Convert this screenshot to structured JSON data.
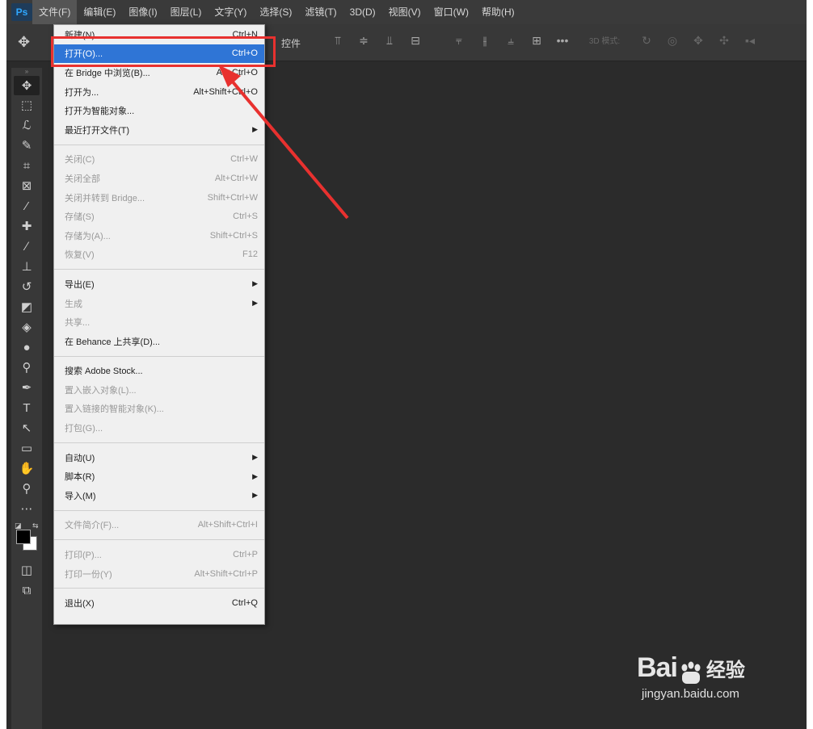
{
  "menubar": {
    "logo": "Ps",
    "items": [
      "文件(F)",
      "编辑(E)",
      "图像(I)",
      "图层(L)",
      "文字(Y)",
      "选择(S)",
      "滤镜(T)",
      "3D(D)",
      "视图(V)",
      "窗口(W)",
      "帮助(H)"
    ]
  },
  "optionsbar": {
    "label": "控件",
    "mode_text": "3D 模式:"
  },
  "file_menu": {
    "items": [
      {
        "label": "新建(N)...",
        "shortcut": "Ctrl+N",
        "state": "normal"
      },
      {
        "label": "打开(O)...",
        "shortcut": "Ctrl+O",
        "state": "highlight"
      },
      {
        "label": "在 Bridge 中浏览(B)...",
        "shortcut": "Alt+Ctrl+O",
        "state": "normal"
      },
      {
        "label": "打开为...",
        "shortcut": "Alt+Shift+Ctrl+O",
        "state": "normal"
      },
      {
        "label": "打开为智能对象...",
        "shortcut": "",
        "state": "normal"
      },
      {
        "label": "最近打开文件(T)",
        "shortcut": "",
        "state": "submenu"
      },
      {
        "sep": true
      },
      {
        "label": "关闭(C)",
        "shortcut": "Ctrl+W",
        "state": "disabled"
      },
      {
        "label": "关闭全部",
        "shortcut": "Alt+Ctrl+W",
        "state": "disabled"
      },
      {
        "label": "关闭并转到 Bridge...",
        "shortcut": "Shift+Ctrl+W",
        "state": "disabled"
      },
      {
        "label": "存储(S)",
        "shortcut": "Ctrl+S",
        "state": "disabled"
      },
      {
        "label": "存储为(A)...",
        "shortcut": "Shift+Ctrl+S",
        "state": "disabled"
      },
      {
        "label": "恢复(V)",
        "shortcut": "F12",
        "state": "disabled"
      },
      {
        "sep": true
      },
      {
        "label": "导出(E)",
        "shortcut": "",
        "state": "submenu"
      },
      {
        "label": "生成",
        "shortcut": "",
        "state": "submenu-disabled"
      },
      {
        "label": "共享...",
        "shortcut": "",
        "state": "disabled"
      },
      {
        "label": "在 Behance 上共享(D)...",
        "shortcut": "",
        "state": "normal"
      },
      {
        "sep": true
      },
      {
        "label": "搜索 Adobe Stock...",
        "shortcut": "",
        "state": "normal"
      },
      {
        "label": "置入嵌入对象(L)...",
        "shortcut": "",
        "state": "disabled"
      },
      {
        "label": "置入链接的智能对象(K)...",
        "shortcut": "",
        "state": "disabled"
      },
      {
        "label": "打包(G)...",
        "shortcut": "",
        "state": "disabled"
      },
      {
        "sep": true
      },
      {
        "label": "自动(U)",
        "shortcut": "",
        "state": "submenu"
      },
      {
        "label": "脚本(R)",
        "shortcut": "",
        "state": "submenu"
      },
      {
        "label": "导入(M)",
        "shortcut": "",
        "state": "submenu"
      },
      {
        "sep": true
      },
      {
        "label": "文件简介(F)...",
        "shortcut": "Alt+Shift+Ctrl+I",
        "state": "disabled"
      },
      {
        "sep": true
      },
      {
        "label": "打印(P)...",
        "shortcut": "Ctrl+P",
        "state": "disabled"
      },
      {
        "label": "打印一份(Y)",
        "shortcut": "Alt+Shift+Ctrl+P",
        "state": "disabled"
      },
      {
        "sep": true
      },
      {
        "label": "退出(X)",
        "shortcut": "Ctrl+Q",
        "state": "normal"
      }
    ]
  },
  "tools": [
    {
      "name": "move-tool-icon",
      "glyph": "✥"
    },
    {
      "name": "marquee-tool-icon",
      "glyph": "⬚"
    },
    {
      "name": "lasso-tool-icon",
      "glyph": "ℒ"
    },
    {
      "name": "quick-select-tool-icon",
      "glyph": "✎"
    },
    {
      "name": "crop-tool-icon",
      "glyph": "⌗"
    },
    {
      "name": "frame-tool-icon",
      "glyph": "⊠"
    },
    {
      "name": "eyedropper-tool-icon",
      "glyph": "⁄"
    },
    {
      "name": "healing-brush-tool-icon",
      "glyph": "✚"
    },
    {
      "name": "brush-tool-icon",
      "glyph": "∕"
    },
    {
      "name": "clone-stamp-tool-icon",
      "glyph": "⊥"
    },
    {
      "name": "history-brush-tool-icon",
      "glyph": "↺"
    },
    {
      "name": "eraser-tool-icon",
      "glyph": "◩"
    },
    {
      "name": "paint-bucket-tool-icon",
      "glyph": "◈"
    },
    {
      "name": "blur-tool-icon",
      "glyph": "●"
    },
    {
      "name": "dodge-tool-icon",
      "glyph": "⚲"
    },
    {
      "name": "pen-tool-icon",
      "glyph": "✒"
    },
    {
      "name": "type-tool-icon",
      "glyph": "T"
    },
    {
      "name": "path-select-tool-icon",
      "glyph": "↖"
    },
    {
      "name": "rectangle-tool-icon",
      "glyph": "▭"
    },
    {
      "name": "hand-tool-icon",
      "glyph": "✋"
    },
    {
      "name": "zoom-tool-icon",
      "glyph": "⚲"
    },
    {
      "name": "more-tools-icon",
      "glyph": "⋯"
    }
  ],
  "colors": {
    "highlight": "#2f75d6",
    "annotation_red": "#e8312f"
  },
  "watermark": {
    "brand_left": "Bai",
    "brand_right": "经验",
    "url": "jingyan.baidu.com"
  }
}
